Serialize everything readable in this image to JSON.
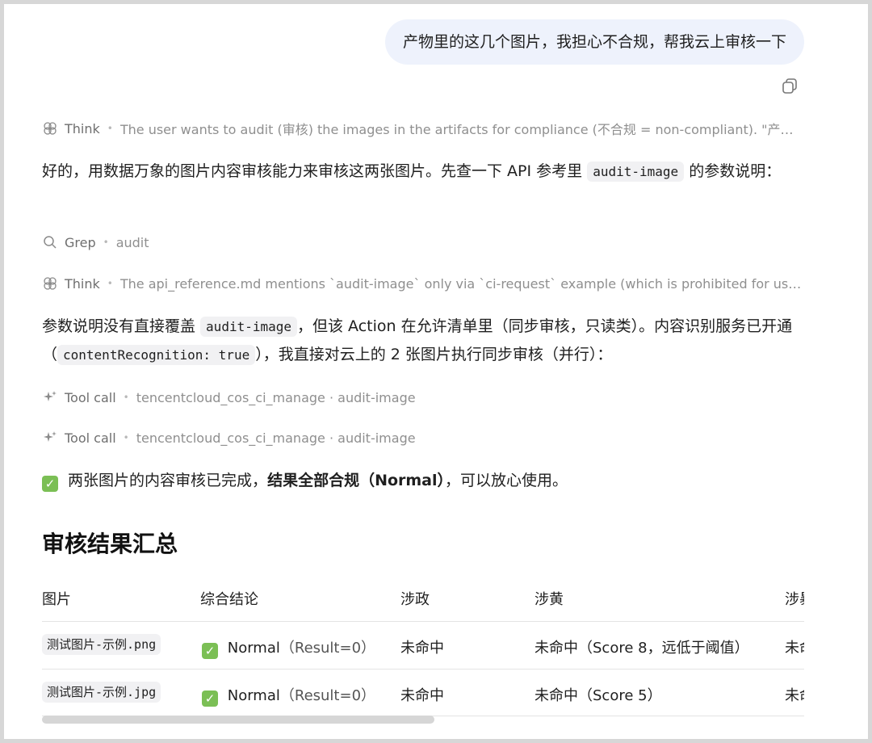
{
  "user_message": "产物里的这几个图片，我担心不合规，帮我云上审核一下",
  "steps": [
    {
      "kind": "Think",
      "icon": "brain-icon",
      "detail": "The user wants to audit (审核) the images in the artifacts for compliance (不合规 = non-compliant). \"产物里…"
    },
    {
      "kind": "Grep",
      "icon": "search-icon",
      "detail": "audit"
    },
    {
      "kind": "Think",
      "icon": "brain-icon",
      "detail": "The api_reference.md mentions `audit-image` only via `ci-request` example (which is prohibited for us). The…"
    },
    {
      "kind": "Tool call",
      "icon": "sparkle-icon",
      "detail": "tencentcloud_cos_ci_manage · audit-image"
    },
    {
      "kind": "Tool call",
      "icon": "sparkle-icon",
      "detail": "tencentcloud_cos_ci_manage · audit-image"
    }
  ],
  "para1": {
    "before": "好的，用数据万象的图片内容审核能力来审核这两张图片。先查一下 API 参考里 ",
    "code": "audit-image",
    "after": " 的参数说明："
  },
  "para2": {
    "p1": "参数说明没有直接覆盖 ",
    "code1": "audit-image",
    "p2": "，但该 Action 在允许清单里（同步审核，只读类）。内容识别服务已开通（",
    "code2": "contentRecognition: true",
    "p3": "），我直接对云上的 2 张图片执行同步审核（并行）："
  },
  "result": {
    "check": "✓",
    "before": "两张图片的内容审核已完成，",
    "bold": "结果全部合规（Normal）",
    "after": "，可以放心使用。"
  },
  "summary_heading": "审核结果汇总",
  "table": {
    "headers": [
      "图片",
      "综合结论",
      "涉政",
      "涉黄",
      "涉暴"
    ],
    "rows": [
      {
        "file": "测试图片-示例.png",
        "verdict": "Normal",
        "verdict_note": "（Result=0）",
        "politics": "未命中",
        "porn": "未命中（Score 8，远低于阈值）",
        "terror": "未命中"
      },
      {
        "file": "测试图片-示例.jpg",
        "verdict": "Normal",
        "verdict_note": "（Result=0）",
        "politics": "未命中",
        "porn": "未命中（Score 5）",
        "terror": "未命中"
      }
    ]
  },
  "colors": {
    "bubble_bg": "#eef2fc",
    "check_green": "#7bbf55",
    "muted_text": "#8a8a8a"
  }
}
